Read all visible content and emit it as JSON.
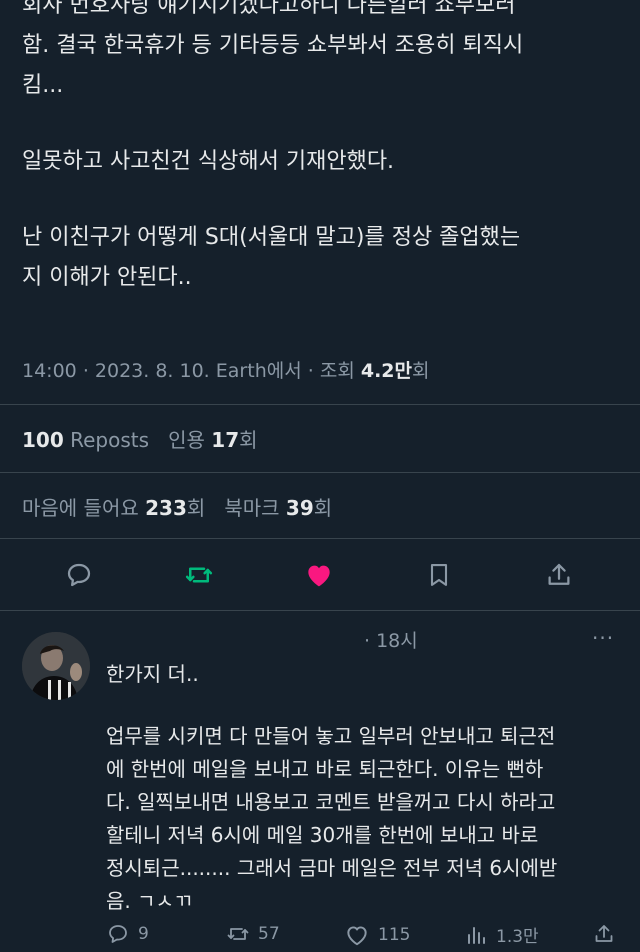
{
  "tweet": {
    "lines": [
      "회사 번호사랑 얘기시기겠다고하니 다른일러 쇼부보러",
      "함. 결국 한국휴가 등 기타등등 쇼부봐서 조용히 퇴직시",
      "킴...",
      "일못하고 사고친건 식상해서 기재안했다.",
      "난 이친구가 어떻게 S대(서울대 말고)를 정상 졸업했는",
      "지 이해가 안된다.."
    ],
    "meta": {
      "time": "14:00",
      "date": "2023. 8. 10.",
      "source": "Earth에서",
      "views_label": "조회",
      "views_value": "4.2만",
      "views_unit": "회"
    },
    "stats": {
      "reposts_count": "100",
      "reposts_label": "Reposts",
      "quotes_label": "인용",
      "quotes_count": "17",
      "quotes_unit": "회",
      "likes_label": "마음에 들어요",
      "likes_count": "233",
      "likes_unit": "회",
      "bookmarks_label": "북마크",
      "bookmarks_count": "39",
      "bookmarks_unit": "회"
    }
  },
  "reply": {
    "time": "· 18시",
    "more": "···",
    "lines": [
      "한가지 더..",
      "업무를 시키면 다 만들어 놓고 일부러 안보내고 퇴근전",
      "에 한번에 메일을 보내고 바로 퇴근한다. 이유는 뻔하",
      "다. 일찍보내면 내용보고 코멘트 받을꺼고 다시 하라고",
      "할테니 저녁 6시에 메일 30개를 한번에 보내고 바로",
      "정시퇴근........ 그래서 금마 메일은 전부 저녁 6시에받",
      "음. ㄱㅅㄲ"
    ],
    "actions": {
      "replies": "9",
      "reposts": "57",
      "likes": "115",
      "views": "1.3만"
    }
  },
  "colors": {
    "background": "#15202b",
    "text": "#e7e9ea",
    "muted": "#8b98a5",
    "divider": "#38444d",
    "like_active": "#f91880"
  },
  "icons": {
    "reply": "speech-bubble-icon",
    "repost": "repost-arrows-icon",
    "like": "heart-icon",
    "bookmark": "bookmark-icon",
    "share": "share-upload-icon",
    "views": "bar-chart-icon",
    "more": "more-dots-icon"
  }
}
